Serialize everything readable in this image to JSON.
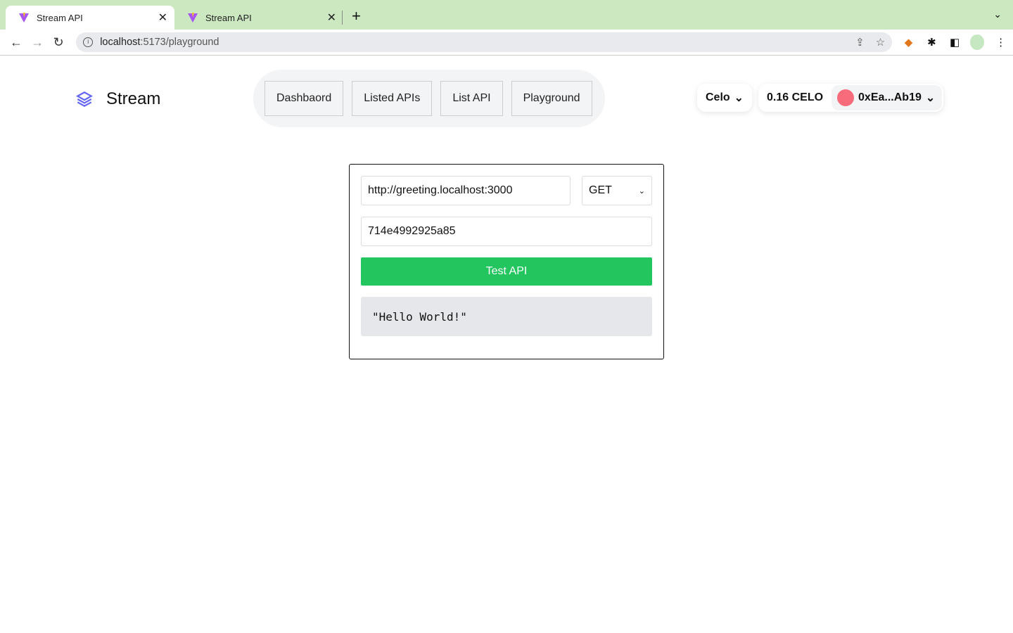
{
  "browser": {
    "tabs": [
      {
        "title": "Stream API",
        "active": true
      },
      {
        "title": "Stream API",
        "active": false
      }
    ],
    "url_host": "localhost",
    "url_path": ":5173/playground"
  },
  "app": {
    "brand": "Stream",
    "nav": [
      "Dashbaord",
      "Listed APIs",
      "List API",
      "Playground"
    ],
    "chain": "Celo",
    "balance": "0.16 CELO",
    "address": "0xEa...Ab19",
    "accent": "#6366f1"
  },
  "playground": {
    "url_value": "http://greeting.localhost:3000",
    "method": "GET",
    "key_value": "714e4992925a85",
    "test_label": "Test API",
    "response": "\"Hello World!\"",
    "button_color": "#22c55e"
  }
}
